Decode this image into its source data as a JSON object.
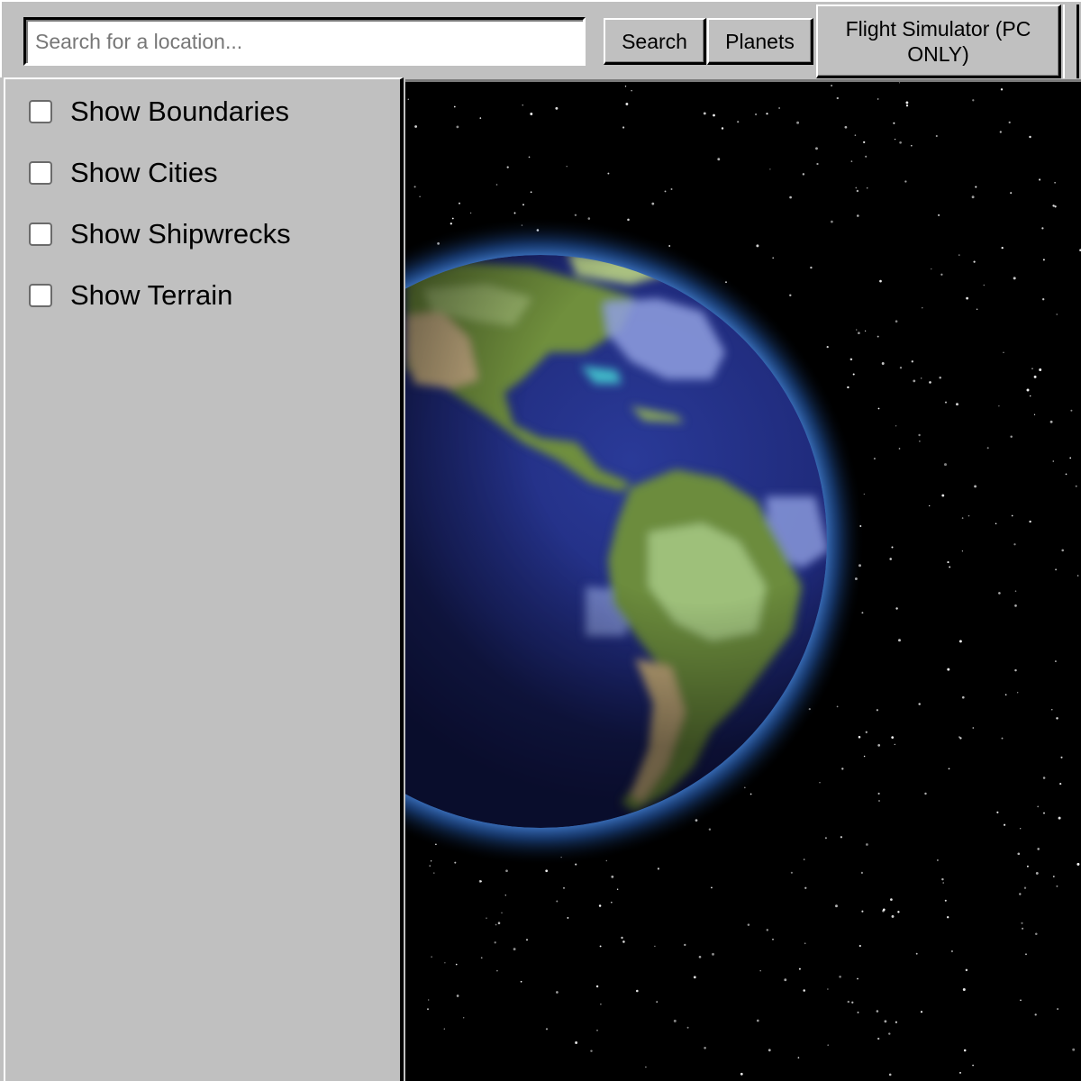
{
  "toolbar": {
    "search": {
      "placeholder": "Search for a location...",
      "value": ""
    },
    "search_button": "Search",
    "planets_button": "Planets",
    "flight_button": "Flight Simulator (PC ONLY)"
  },
  "sidebar": {
    "options": [
      {
        "label": "Show Boundaries",
        "checked": false
      },
      {
        "label": "Show Cities",
        "checked": false
      },
      {
        "label": "Show Shipwrecks",
        "checked": false
      },
      {
        "label": "Show Terrain",
        "checked": false
      }
    ]
  },
  "viewport": {
    "planet": "earth-globe",
    "background": "starfield",
    "colors": {
      "space": "#000000",
      "ocean": "#1e2a78",
      "land": "#7a9a48",
      "atmosphere": "#4a8cff"
    }
  }
}
